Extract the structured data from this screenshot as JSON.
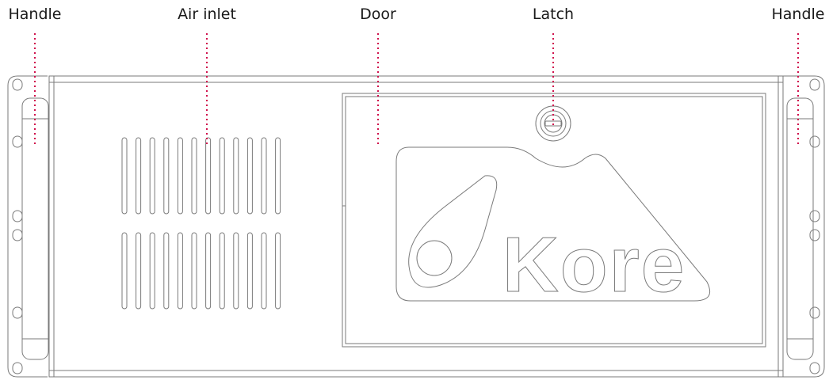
{
  "callouts": [
    {
      "id": "handle-left",
      "label": "Handle"
    },
    {
      "id": "air-inlet",
      "label": "Air inlet"
    },
    {
      "id": "door",
      "label": "Door"
    },
    {
      "id": "latch",
      "label": "Latch"
    },
    {
      "id": "handle-right",
      "label": "Handle"
    }
  ],
  "logo": {
    "text": "Kore"
  },
  "colors": {
    "line": "#7a7a7a",
    "leader": "#d0104c",
    "label": "#1a1a1a"
  }
}
